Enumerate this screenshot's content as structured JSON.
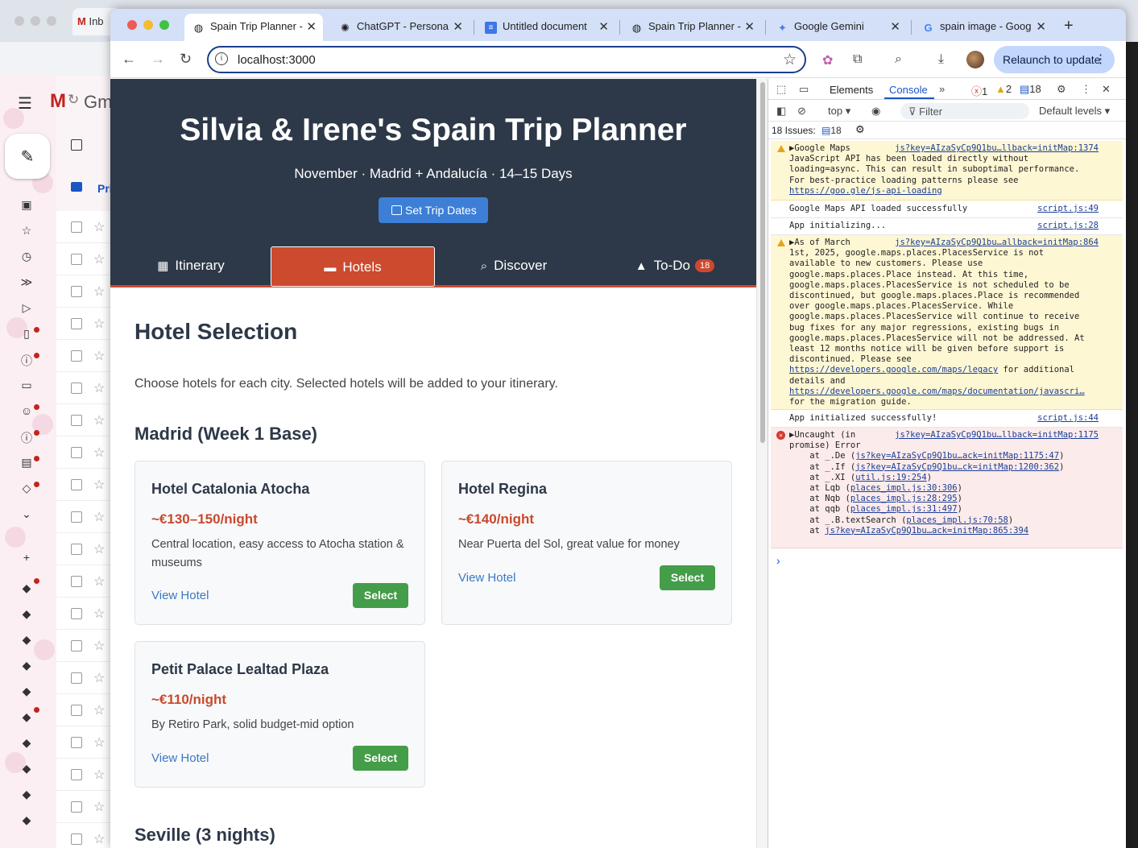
{
  "background_window": {
    "tab_label": "Inb",
    "app_label": "Gm",
    "side_tab_label": "Pri"
  },
  "browser": {
    "tabs": [
      {
        "label": "Spain Trip Planner -",
        "icon": "globe-icon",
        "active": true
      },
      {
        "label": "ChatGPT - Persona",
        "icon": "chatgpt-icon",
        "active": false
      },
      {
        "label": "Untitled document",
        "icon": "docs-icon",
        "active": false
      },
      {
        "label": "Spain Trip Planner -",
        "icon": "globe-icon",
        "active": false
      },
      {
        "label": "Google Gemini",
        "icon": "gemini-icon",
        "active": false
      },
      {
        "label": "spain image - Goog",
        "icon": "google-icon",
        "active": false
      }
    ],
    "url": "localhost:3000",
    "relaunch_label": "Relaunch to update"
  },
  "page": {
    "title": "Silvia & Irene's Spain Trip Planner",
    "subtitle": "November · Madrid + Andalucía · 14–15 Days",
    "set_dates_label": "Set Trip Dates",
    "nav": [
      {
        "label": "Itinerary",
        "icon": "calendar-icon"
      },
      {
        "label": "Hotels",
        "icon": "bed-icon"
      },
      {
        "label": "Discover",
        "icon": "search-icon"
      },
      {
        "label": "To-Do",
        "icon": "warning-icon",
        "badge": "18"
      }
    ],
    "section_title": "Hotel Selection",
    "intro": "Choose hotels for each city. Selected hotels will be added to your itinerary.",
    "cities": [
      {
        "name": "Madrid (Week 1 Base)",
        "hotels": [
          {
            "name": "Hotel Catalonia Atocha",
            "price": "~€130–150/night",
            "desc": "Central location, easy access to Atocha station & museums",
            "link": "View Hotel",
            "select": "Select"
          },
          {
            "name": "Hotel Regina",
            "price": "~€140/night",
            "desc": "Near Puerta del Sol, great value for money",
            "link": "View Hotel",
            "select": "Select"
          },
          {
            "name": "Petit Palace Lealtad Plaza",
            "price": "~€110/night",
            "desc": "By Retiro Park, solid budget-mid option",
            "link": "View Hotel",
            "select": "Select"
          }
        ]
      },
      {
        "name": "Seville (3 nights)"
      }
    ]
  },
  "devtools": {
    "tabs": [
      "Elements",
      "Console"
    ],
    "active_tab": "Console",
    "error_count": "1",
    "warning_count": "2",
    "info_count": "18",
    "context": "top",
    "filter_placeholder": "Filter",
    "levels": "Default levels",
    "issues_label": "18 Issues:",
    "issues_count": "18",
    "messages": [
      {
        "type": "warn",
        "src": "js?key=AIzaSyCp9Q1bu…llback=initMap:1374",
        "text": "▶Google Maps\nJavaScript API has been loaded directly without\nloading=async. This can result in suboptimal performance.\nFor best-practice loading patterns please see",
        "link": "https://goo.gle/js-api-loading"
      },
      {
        "type": "log",
        "src": "script.js:49",
        "text": "Google Maps API loaded successfully"
      },
      {
        "type": "log",
        "src": "script.js:28",
        "text": "App initializing..."
      },
      {
        "type": "warn",
        "src": "js?key=AIzaSyCp9Q1bu…allback=initMap:864",
        "text": "▶As of March\n1st, 2025, google.maps.places.PlacesService is not\navailable to new customers. Please use\ngoogle.maps.places.Place instead. At this time,\ngoogle.maps.places.PlacesService is not scheduled to be\ndiscontinued, but google.maps.places.Place is recommended\nover google.maps.places.PlacesService. While\ngoogle.maps.places.PlacesService will continue to receive\nbug fixes for any major regressions, existing bugs in\ngoogle.maps.places.PlacesService will not be addressed. At\nleast 12 months notice will be given before support is\ndiscontinued. Please see",
        "link": "https://developers.google.com/maps/legacy",
        "after_link": " for additional\ndetails and",
        "link2": "https://developers.google.com/maps/documentation/javascri…",
        "tail": "for the migration guide."
      },
      {
        "type": "log",
        "src": "script.js:44",
        "text": "App initialized successfully!"
      },
      {
        "type": "err",
        "src": "js?key=AIzaSyCp9Q1bu…llback=initMap:1175",
        "text": "▶Uncaught (in\npromise) Error",
        "stack": [
          {
            "pre": "    at _.De (",
            "link": "js?key=AIzaSyCp9Q1bu…ack=initMap:1175:47",
            "post": ")"
          },
          {
            "pre": "    at _.If (",
            "link": "js?key=AIzaSyCp9Q1bu…ck=initMap:1200:362",
            "post": ")"
          },
          {
            "pre": "    at _.XI (",
            "link": "util.js:19:254",
            "post": ")"
          },
          {
            "pre": "    at Lqb (",
            "link": "places_impl.js:30:306",
            "post": ")"
          },
          {
            "pre": "    at Nqb (",
            "link": "places_impl.js:28:295",
            "post": ")"
          },
          {
            "pre": "    at qqb (",
            "link": "places_impl.js:31:497",
            "post": ")"
          },
          {
            "pre": "    at _.B.textSearch (",
            "link": "places_impl.js:70:58",
            "post": ")"
          },
          {
            "pre": "    at ",
            "link": "js?key=AIzaSyCp9Q1bu…ack=initMap:865:394",
            "post": ""
          }
        ]
      }
    ]
  },
  "colors": {
    "hero_bg": "#2d3848",
    "accent": "#cc4a2e",
    "select_green": "#449d48",
    "link_blue": "#3a78c3"
  }
}
